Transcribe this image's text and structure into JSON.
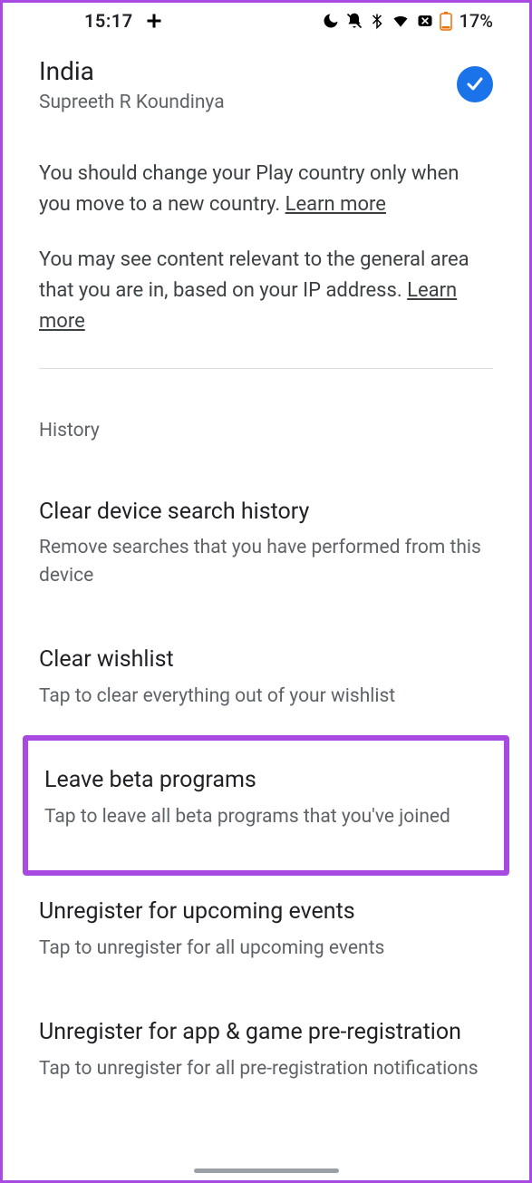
{
  "status": {
    "time": "15:17",
    "battery_text": "17%"
  },
  "country": {
    "title": "India",
    "subtitle": "Supreeth R Koundinya"
  },
  "info1": {
    "text": "You should change your Play country only when you move to a new country. ",
    "link": "Learn more"
  },
  "info2": {
    "text": "You may see content relevant to the general area that you are in, based on your IP address. ",
    "link": "Learn more"
  },
  "history_label": "History",
  "items": {
    "clear_search": {
      "title": "Clear device search history",
      "desc": "Remove searches that you have performed from this device"
    },
    "clear_wishlist": {
      "title": "Clear wishlist",
      "desc": "Tap to clear everything out of your wishlist"
    },
    "leave_beta": {
      "title": "Leave beta programs",
      "desc": "Tap to leave all beta programs that you've joined"
    },
    "unregister_events": {
      "title": "Unregister for upcoming events",
      "desc": "Tap to unregister for all upcoming events"
    },
    "unregister_prereg": {
      "title": "Unregister for app & game pre-registration",
      "desc": "Tap to unregister for all pre-registration notifications"
    }
  }
}
